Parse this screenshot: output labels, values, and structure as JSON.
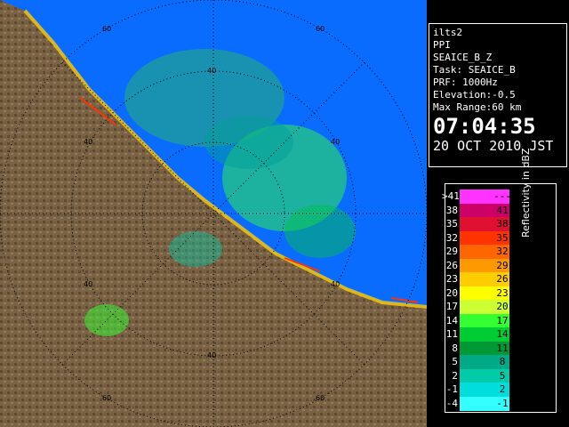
{
  "info": {
    "station": "ilts2",
    "scan_mode": "PPI",
    "product": "SEAICE_B_Z",
    "task": "Task: SEAICE_B",
    "prf": "PRF: 1000Hz",
    "elevation": "Elevation:-0.5",
    "max_range": "Max Range:60 km",
    "time": "07:04:35",
    "date": "20 OCT 2010 JST"
  },
  "legend": {
    "title": "Reflectivity in dBZ",
    "rows": [
      {
        "left": ">41",
        "right": "---",
        "color": "#ff33ff"
      },
      {
        "left": "38",
        "right": "41",
        "color": "#cc0066"
      },
      {
        "left": "35",
        "right": "38",
        "color": "#e01030"
      },
      {
        "left": "32",
        "right": "35",
        "color": "#ff3300"
      },
      {
        "left": "29",
        "right": "32",
        "color": "#ff6600"
      },
      {
        "left": "26",
        "right": "29",
        "color": "#ff9900"
      },
      {
        "left": "23",
        "right": "26",
        "color": "#ffcc00"
      },
      {
        "left": "20",
        "right": "23",
        "color": "#ffff00"
      },
      {
        "left": "17",
        "right": "20",
        "color": "#ccff33"
      },
      {
        "left": "14",
        "right": "17",
        "color": "#33ff33"
      },
      {
        "left": "11",
        "right": "14",
        "color": "#00cc33"
      },
      {
        "left": "8",
        "right": "11",
        "color": "#009933"
      },
      {
        "left": "5",
        "right": "8",
        "color": "#00aa88"
      },
      {
        "left": "2",
        "right": "5",
        "color": "#00ccaa"
      },
      {
        "left": "-1",
        "right": "2",
        "color": "#00dddd"
      },
      {
        "left": "-4",
        "right": "-1",
        "color": "#33ffff"
      }
    ]
  },
  "map": {
    "ring_labels": [
      "40",
      "60",
      "40",
      "60",
      "40",
      "40",
      "40",
      "60",
      "40",
      "60"
    ],
    "sea_color": "#0a6cff",
    "land_color": "#7a6244"
  }
}
